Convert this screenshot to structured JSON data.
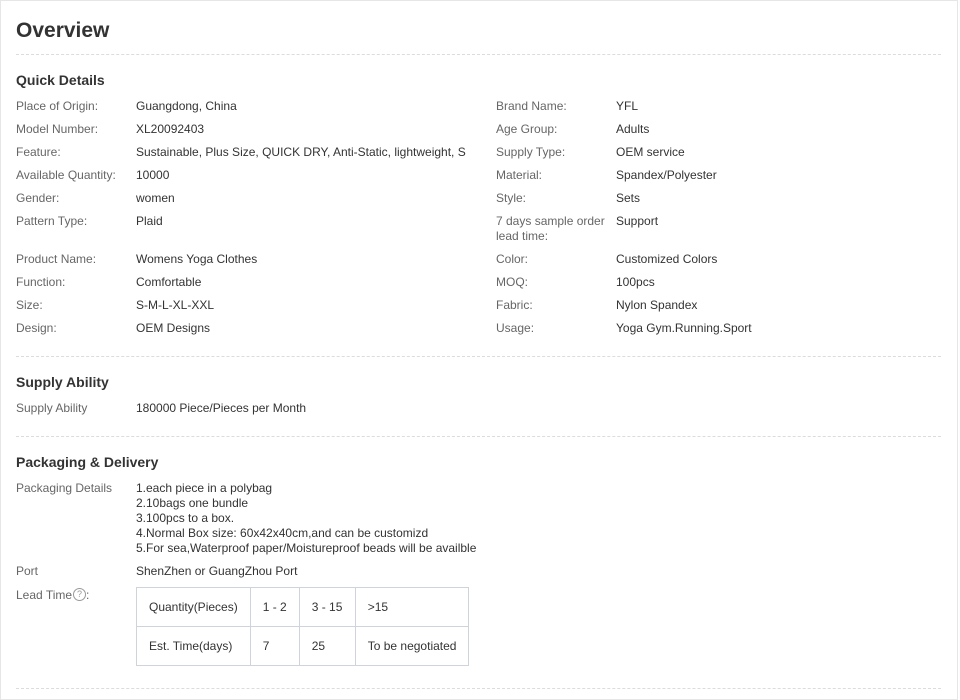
{
  "page_title": "Overview",
  "quick_details": {
    "title": "Quick Details",
    "left": [
      {
        "label": "Place of Origin:",
        "value": "Guangdong, China"
      },
      {
        "label": "Model Number:",
        "value": "XL20092403"
      },
      {
        "label": "Feature:",
        "value": "Sustainable, Plus Size, QUICK DRY, Anti-Static, lightweight, S..."
      },
      {
        "label": "Available Quantity:",
        "value": "10000"
      },
      {
        "label": "Gender:",
        "value": "women"
      },
      {
        "label": "Pattern Type:",
        "value": "Plaid"
      },
      {
        "label": "Product Name:",
        "value": "Womens Yoga Clothes"
      },
      {
        "label": "Function:",
        "value": "Comfortable"
      },
      {
        "label": "Size:",
        "value": "S-M-L-XL-XXL"
      },
      {
        "label": "Design:",
        "value": "OEM Designs"
      }
    ],
    "right": [
      {
        "label": "Brand Name:",
        "value": "YFL"
      },
      {
        "label": "Age Group:",
        "value": "Adults"
      },
      {
        "label": "Supply Type:",
        "value": "OEM service"
      },
      {
        "label": "Material:",
        "value": "Spandex/Polyester"
      },
      {
        "label": "Style:",
        "value": "Sets"
      },
      {
        "label": "7 days sample order lead time:",
        "value": "Support"
      },
      {
        "label": "Color:",
        "value": "Customized Colors"
      },
      {
        "label": "MOQ:",
        "value": "100pcs"
      },
      {
        "label": "Fabric:",
        "value": "Nylon Spandex"
      },
      {
        "label": "Usage:",
        "value": "Yoga Gym.Running.Sport"
      }
    ]
  },
  "supply_ability": {
    "title": "Supply Ability",
    "label": "Supply Ability",
    "value": "180000 Piece/Pieces per Month"
  },
  "packaging": {
    "title": "Packaging & Delivery",
    "details_label": "Packaging Details",
    "details_lines": [
      "1.each piece in a polybag",
      "2.10bags one bundle",
      "3.100pcs to a box.",
      "4.Normal Box size: 60x42x40cm,and can be customizd",
      "5.For sea,Waterproof paper/Moistureproof beads will be availble"
    ],
    "port_label": "Port",
    "port_value": "ShenZhen or GuangZhou Port",
    "lead_time_label": "Lead Time",
    "help_glyph": "?",
    "lead_table": {
      "rows": [
        [
          "Quantity(Pieces)",
          "1 - 2",
          "3 - 15",
          ">15"
        ],
        [
          "Est. Time(days)",
          "7",
          "25",
          "To be negotiated"
        ]
      ]
    }
  }
}
